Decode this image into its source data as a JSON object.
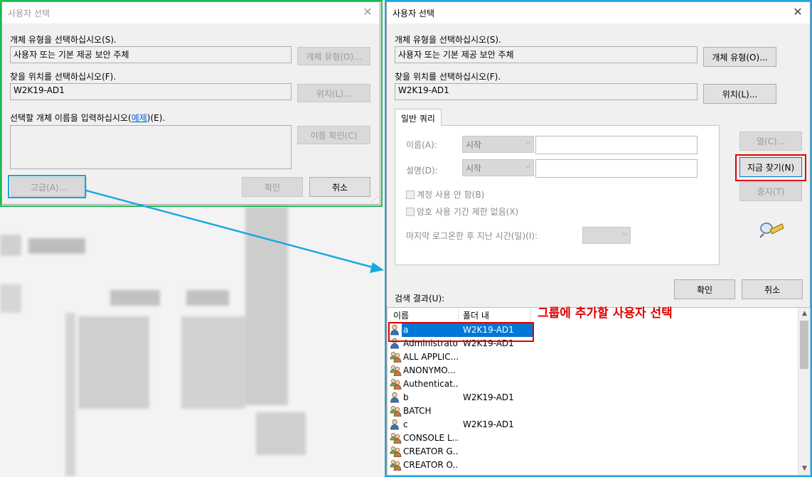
{
  "left_dialog": {
    "title": "사용자 선택",
    "object_type_label": "개체 유형을 선택하십시오(S).",
    "object_type_value": "사용자 또는 기본 제공 보안 주체",
    "object_type_button": "개체 유형(O)...",
    "location_label": "찾을 위치를 선택하십시오(F).",
    "location_value": "W2K19-AD1",
    "location_button": "위치(L)...",
    "names_label_prefix": "선택할 개체 이름을 입력하십시오(",
    "names_label_link": "예제",
    "names_label_suffix": ")(E).",
    "check_names_button": "이름 확인(C)",
    "advanced_button": "고급(A)...",
    "ok_button": "확인",
    "cancel_button": "취소"
  },
  "right_dialog": {
    "title": "사용자 선택",
    "object_type_label": "개체 유형을 선택하십시오(S).",
    "object_type_value": "사용자 또는 기본 제공 보안 주체",
    "object_type_button": "개체 유형(O)...",
    "location_label": "찾을 위치를 선택하십시오(F).",
    "location_value": "W2K19-AD1",
    "location_button": "위치(L)...",
    "tab_label": "일반 쿼리",
    "name_label": "이름(A):",
    "name_combo": "시작",
    "desc_label": "설명(D):",
    "desc_combo": "시작",
    "disabled_accounts": "계정 사용 안 함(B)",
    "non_expiring_password": "암호 사용 기간 제한 없음(X)",
    "days_since_logon": "마지막 로그온한 후 지난 시간(일)(I):",
    "columns_button": "열(C)...",
    "find_now_button": "지금 찾기(N)",
    "stop_button": "중지(T)",
    "ok_button": "확인",
    "cancel_button": "취소",
    "results_label": "검색 결과(U):",
    "results_columns": [
      "이름",
      "폴더 내"
    ],
    "results": [
      {
        "name": "a",
        "folder": "W2K19-AD1",
        "icon": "user-icon",
        "selected": true
      },
      {
        "name": "Administrator",
        "folder": "W2K19-AD1",
        "icon": "user-icon"
      },
      {
        "name": "ALL APPLIC...",
        "folder": "",
        "icon": "group-icon"
      },
      {
        "name": "ANONYMO...",
        "folder": "",
        "icon": "group-icon"
      },
      {
        "name": "Authenticat...",
        "folder": "",
        "icon": "group-icon"
      },
      {
        "name": "b",
        "folder": "W2K19-AD1",
        "icon": "user-icon"
      },
      {
        "name": "BATCH",
        "folder": "",
        "icon": "group-icon"
      },
      {
        "name": "c",
        "folder": "W2K19-AD1",
        "icon": "user-icon"
      },
      {
        "name": "CONSOLE L...",
        "folder": "",
        "icon": "group-icon"
      },
      {
        "name": "CREATOR G...",
        "folder": "",
        "icon": "group-icon"
      },
      {
        "name": "CREATOR O...",
        "folder": "",
        "icon": "group-icon"
      }
    ]
  },
  "annotation": {
    "text": "그룹에 추가할 사용자 선택",
    "color": "#e00000",
    "arrow_color": "#19a8e0",
    "left_frame_color": "#1db954",
    "right_frame_color": "#19a8e0"
  }
}
